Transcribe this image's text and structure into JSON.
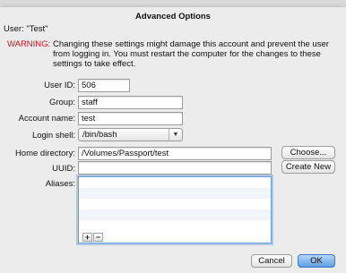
{
  "dialog": {
    "title": "Advanced Options",
    "user_line": "User: \"Test\"",
    "warning_label": "WARNING:",
    "warning_text": "Changing these settings might damage this account and prevent the user from logging in. You must restart the computer for the changes to these settings to take effect."
  },
  "form": {
    "user_id_label": "User ID:",
    "user_id_value": "506",
    "group_label": "Group:",
    "group_value": "staff",
    "account_name_label": "Account name:",
    "account_name_value": "test",
    "login_shell_label": "Login shell:",
    "login_shell_value": "/bin/bash",
    "home_directory_label": "Home directory:",
    "home_directory_value": "/Volumes/Passport/test",
    "uuid_label": "UUID:",
    "uuid_value": "",
    "aliases_label": "Aliases:"
  },
  "buttons": {
    "choose": "Choose...",
    "create_new": "Create New",
    "add": "+",
    "remove": "−",
    "cancel": "Cancel",
    "ok": "OK"
  },
  "colors": {
    "warning": "#d01010",
    "focus": "#6a9cd9",
    "default_button": "#5b9ee6"
  }
}
